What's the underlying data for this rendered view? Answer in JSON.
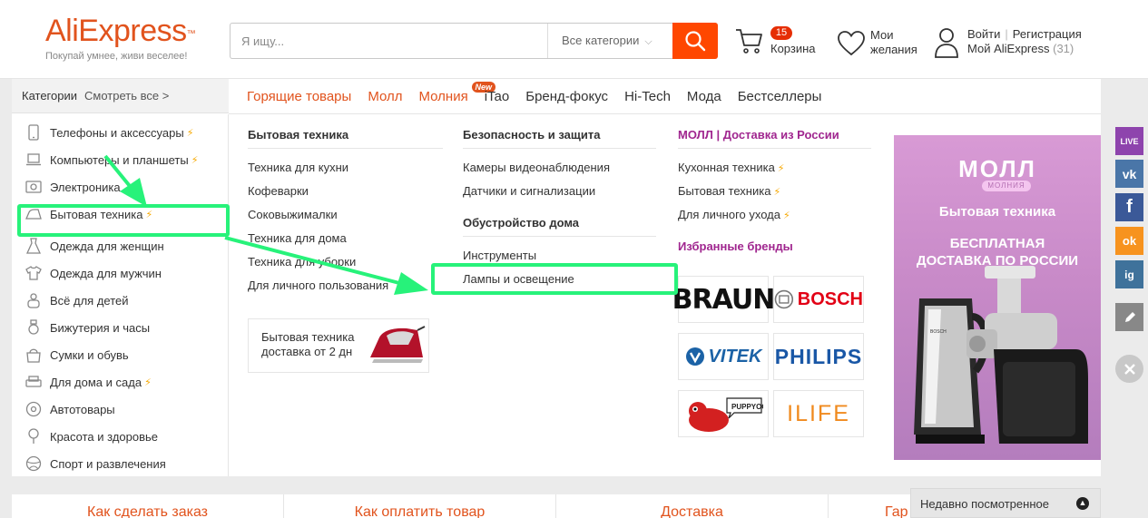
{
  "header": {
    "logo_part1": "Ali",
    "logo_part2": "Express",
    "logo_tm": "™",
    "slogan": "Покупай умнее, живи веселее!",
    "search_placeholder": "Я ищу...",
    "search_category": "Все категории",
    "cart_count": "15",
    "cart_label": "Корзина",
    "wish_label": "Мои желания",
    "login": "Войти",
    "register": "Регистрация",
    "my_account": "Мой AliExpress",
    "account_count": "(31)"
  },
  "categories_header": {
    "title": "Категории",
    "see_all": "Смотреть все >"
  },
  "top_nav": [
    {
      "label": "Горящие товары"
    },
    {
      "label": "Молл"
    },
    {
      "label": "Молния",
      "badge": "New"
    },
    {
      "label": "iTao"
    },
    {
      "label": "Бренд-фокус"
    },
    {
      "label": "Hi-Tech"
    },
    {
      "label": "Мода"
    },
    {
      "label": "Бестселлеры"
    }
  ],
  "sidebar": [
    {
      "label": "Телефоны и аксессуары",
      "bolt": true
    },
    {
      "label": "Компьютеры и планшеты",
      "bolt": true
    },
    {
      "label": "Электроника",
      "bolt": false
    },
    {
      "label": "Бытовая техника",
      "bolt": true
    },
    {
      "label": "Одежда для женщин",
      "bolt": false
    },
    {
      "label": "Одежда для мужчин",
      "bolt": false
    },
    {
      "label": "Всё для детей",
      "bolt": false
    },
    {
      "label": "Бижутерия и часы",
      "bolt": false
    },
    {
      "label": "Сумки и обувь",
      "bolt": false
    },
    {
      "label": "Для дома и сада",
      "bolt": true
    },
    {
      "label": "Автотовары",
      "bolt": false
    },
    {
      "label": "Красота и здоровье",
      "bolt": false
    },
    {
      "label": "Спорт и развлечения",
      "bolt": false
    }
  ],
  "bolt_symbol": "⚡",
  "col1": {
    "title": "Бытовая техника",
    "links": [
      "Техника для кухни",
      "Кофеварки",
      "Соковыжималки",
      "Техника для дома",
      "Техника для уборки",
      "Для личного пользования"
    ],
    "promo": "Бытовая техника доставка от 2 дн"
  },
  "col2": {
    "title1": "Безопасность и защита",
    "links1": [
      "Камеры видеонаблюдения",
      "Датчики и сигнализации"
    ],
    "title2": "Обустройство дома",
    "links2": [
      "Инструменты",
      "Лампы и освещение"
    ]
  },
  "col3": {
    "title": "МОЛЛ | Доставка из России",
    "links": [
      "Кухонная техника",
      "Бытовая техника",
      "Для личного ухода"
    ],
    "brands_title": "Избранные бренды",
    "brands": [
      "BRAUN",
      "BOSCH",
      "VITEK",
      "PHILIPS",
      "PUPPYOO",
      "ILIFE"
    ]
  },
  "ad": {
    "moll": "МОЛЛ",
    "molnia": "МОЛНИЯ",
    "subtitle": "Бытовая техника",
    "free_delivery": "БЕСПЛАТНАЯ ДОСТАВКА ПО РОССИИ",
    "product_brand": "BOSCH"
  },
  "social": {
    "live": "LIVE",
    "vk": "vk",
    "fb": "f",
    "ok": "ok",
    "ig": "ig",
    "colors": {
      "live": "#8e44ad",
      "vk": "#4a76a8",
      "fb": "#3b5998",
      "ok": "#f7931e",
      "ig": "#3f729b",
      "edit": "#888888",
      "close": "#c8c8c8"
    }
  },
  "bottom_tabs": [
    "Как сделать заказ",
    "Как оплатить товар",
    "Доставка",
    "Гар"
  ],
  "recently_viewed": "Недавно посмотренное",
  "colors": {
    "accent": "#ff4700",
    "brand_orange": "#e1531d",
    "highlight": "#27f27a",
    "bolt": "#f6a800",
    "magenta": "#a0268f"
  }
}
